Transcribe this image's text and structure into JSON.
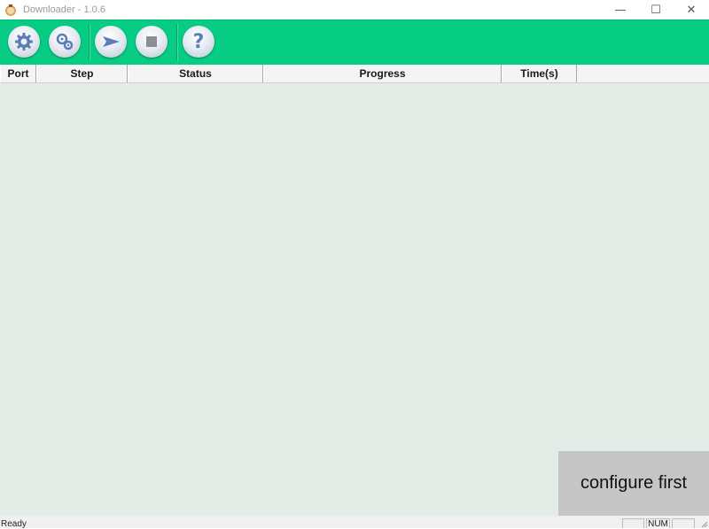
{
  "window": {
    "title": "Downloader - 1.0.6",
    "controls": {
      "minimize": "—",
      "maximize": "☐",
      "close": "✕"
    }
  },
  "toolbar": {
    "buttons": [
      {
        "icon": "gear-icon",
        "action": "settings"
      },
      {
        "icon": "gears-icon",
        "action": "configure"
      },
      {
        "icon": "play-arrow-icon",
        "action": "start"
      },
      {
        "icon": "stop-icon",
        "action": "stop"
      },
      {
        "icon": "help-icon",
        "action": "help",
        "glyph": "?"
      }
    ],
    "color": "#06cc84"
  },
  "table": {
    "columns": [
      "Port",
      "Step",
      "Status",
      "Progress",
      "Time(s)"
    ],
    "rows": []
  },
  "toast": {
    "text": "configure first"
  },
  "statusbar": {
    "text": "Ready",
    "indicators": [
      "",
      "NUM",
      ""
    ]
  }
}
